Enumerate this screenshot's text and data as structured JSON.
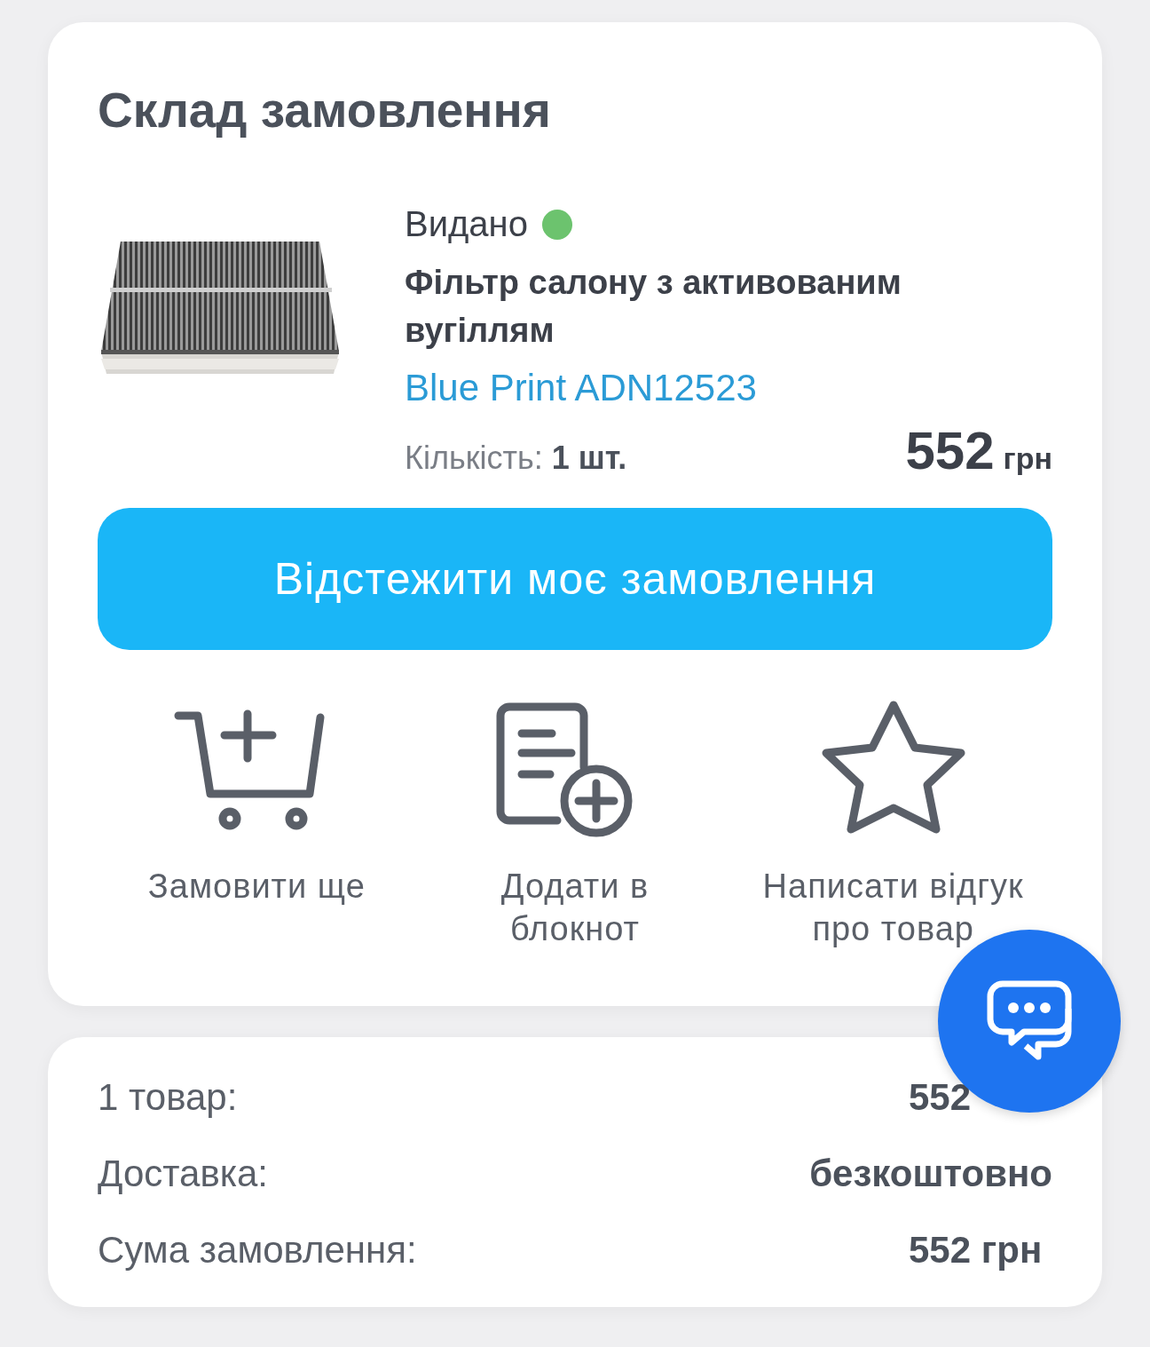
{
  "order": {
    "title": "Склад замовлення",
    "item": {
      "status": "Видано",
      "color": "#6cc36e",
      "name": "Фільтр салону з активованим вугіллям",
      "brand_link": "Blue Print ADN12523",
      "quantity": "Кількість: **1 шт.**",
      "price": "552",
      "currency": "грн"
    },
    "track_button": "Відстежити моє замовлення",
    "actions": [
      {
        "kind": "cart",
        "label": "Замовити ще"
      },
      {
        "kind": "notepad",
        "label": "Додати в блокнот"
      },
      {
        "kind": "star",
        "label": "Написати відгук про товар"
      }
    ]
  },
  "summary": [
    {
      "label": "1 товар:",
      "value": "552"
    },
    {
      "label": "Доставка:",
      "value": "безкоштовно"
    },
    {
      "label": "Сума замовлення:",
      "value": "552 грн"
    }
  ],
  "chat_button": {
    "kind": "chat"
  }
}
